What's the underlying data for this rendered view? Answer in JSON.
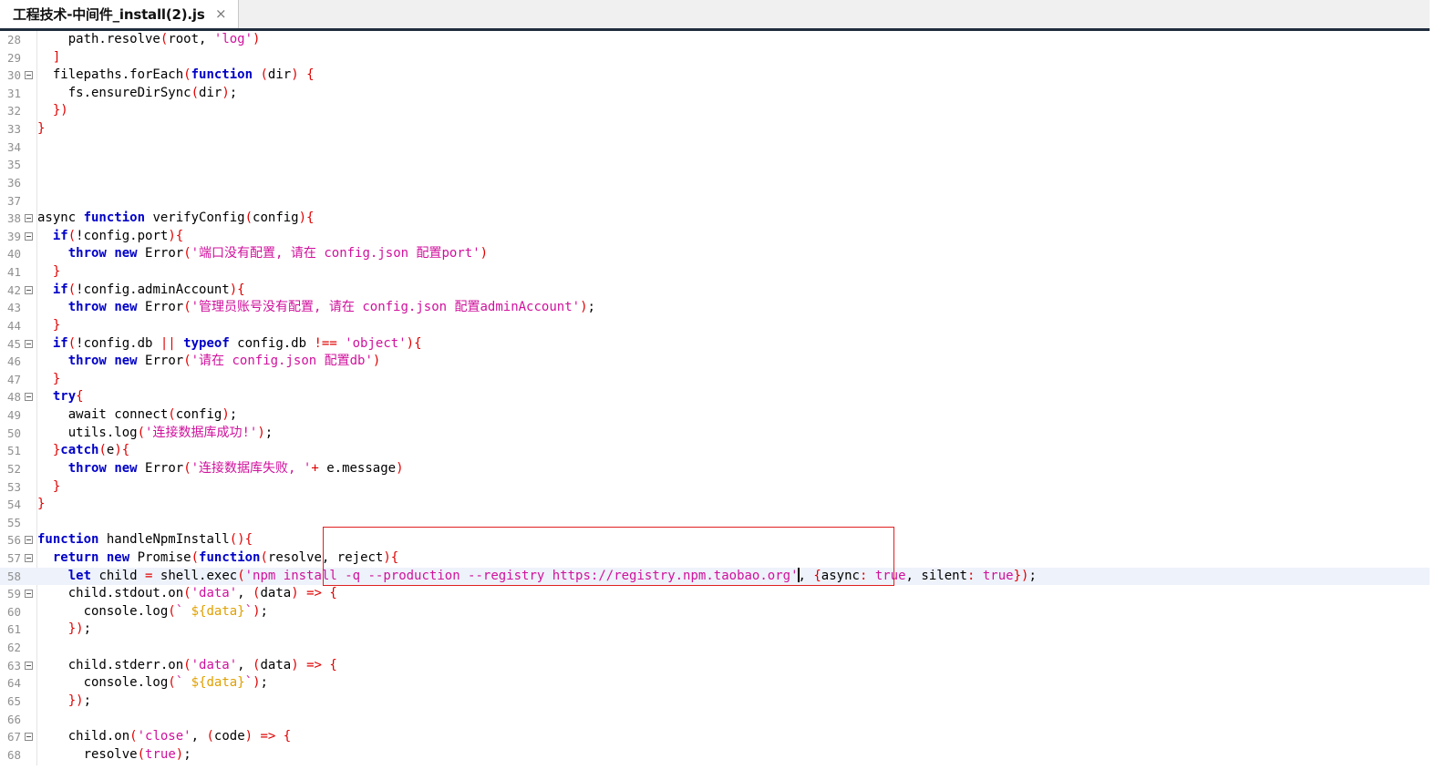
{
  "tab": {
    "title": "工程技术-中间件_install(2).js",
    "close_glyph": "×"
  },
  "editor": {
    "current_line": 58,
    "lines": [
      {
        "n": "28",
        "fold": false,
        "indent": 2,
        "tokens": [
          [
            "t",
            "path.resolve"
          ],
          [
            "br",
            "("
          ],
          [
            "t",
            "root, "
          ],
          [
            "str",
            "'log'"
          ],
          [
            "br",
            ")"
          ]
        ]
      },
      {
        "n": "29",
        "fold": false,
        "indent": 1,
        "tokens": [
          [
            "br",
            "]"
          ]
        ]
      },
      {
        "n": "30",
        "fold": true,
        "indent": 1,
        "tokens": [
          [
            "t",
            "filepaths.forEach"
          ],
          [
            "br",
            "("
          ],
          [
            "kw",
            "function"
          ],
          [
            "t",
            " "
          ],
          [
            "br",
            "("
          ],
          [
            "t",
            "dir"
          ],
          [
            "br",
            ")"
          ],
          [
            "t",
            " "
          ],
          [
            "br",
            "{"
          ]
        ]
      },
      {
        "n": "31",
        "fold": false,
        "indent": 2,
        "tokens": [
          [
            "t",
            "fs.ensureDirSync"
          ],
          [
            "br",
            "("
          ],
          [
            "t",
            "dir"
          ],
          [
            "br",
            ")"
          ],
          [
            "t",
            ";"
          ]
        ]
      },
      {
        "n": "32",
        "fold": false,
        "indent": 1,
        "tokens": [
          [
            "br",
            "})"
          ]
        ]
      },
      {
        "n": "33",
        "fold": false,
        "indent": 0,
        "tokens": [
          [
            "br",
            "}"
          ]
        ]
      },
      {
        "n": "34",
        "fold": false,
        "indent": 0,
        "tokens": []
      },
      {
        "n": "35",
        "fold": false,
        "indent": 0,
        "tokens": []
      },
      {
        "n": "36",
        "fold": false,
        "indent": 0,
        "tokens": []
      },
      {
        "n": "37",
        "fold": false,
        "indent": 0,
        "tokens": []
      },
      {
        "n": "38",
        "fold": true,
        "indent": 0,
        "tokens": [
          [
            "t",
            "async "
          ],
          [
            "kw",
            "function"
          ],
          [
            "t",
            " verifyConfig"
          ],
          [
            "br",
            "("
          ],
          [
            "t",
            "config"
          ],
          [
            "br",
            "){"
          ]
        ]
      },
      {
        "n": "39",
        "fold": true,
        "indent": 1,
        "tokens": [
          [
            "kw",
            "if"
          ],
          [
            "br",
            "("
          ],
          [
            "t",
            "!config.port"
          ],
          [
            "br",
            "){"
          ]
        ]
      },
      {
        "n": "40",
        "fold": false,
        "indent": 2,
        "tokens": [
          [
            "kw",
            "throw"
          ],
          [
            "t",
            " "
          ],
          [
            "kw",
            "new"
          ],
          [
            "t",
            " Error"
          ],
          [
            "br",
            "("
          ],
          [
            "str",
            "'端口没有配置, 请在 config.json 配置port'"
          ],
          [
            "br",
            ")"
          ]
        ]
      },
      {
        "n": "41",
        "fold": false,
        "indent": 1,
        "tokens": [
          [
            "br",
            "}"
          ]
        ]
      },
      {
        "n": "42",
        "fold": true,
        "indent": 1,
        "tokens": [
          [
            "kw",
            "if"
          ],
          [
            "br",
            "("
          ],
          [
            "t",
            "!config.adminAccount"
          ],
          [
            "br",
            "){"
          ]
        ]
      },
      {
        "n": "43",
        "fold": false,
        "indent": 2,
        "tokens": [
          [
            "kw",
            "throw"
          ],
          [
            "t",
            " "
          ],
          [
            "kw",
            "new"
          ],
          [
            "t",
            " Error"
          ],
          [
            "br",
            "("
          ],
          [
            "str",
            "'管理员账号没有配置, 请在 config.json 配置adminAccount'"
          ],
          [
            "br",
            ")"
          ],
          [
            "t",
            ";"
          ]
        ]
      },
      {
        "n": "44",
        "fold": false,
        "indent": 1,
        "tokens": [
          [
            "br",
            "}"
          ]
        ]
      },
      {
        "n": "45",
        "fold": true,
        "indent": 1,
        "tokens": [
          [
            "kw",
            "if"
          ],
          [
            "br",
            "("
          ],
          [
            "t",
            "!config.db "
          ],
          [
            "br",
            "||"
          ],
          [
            "t",
            " "
          ],
          [
            "kw",
            "typeof"
          ],
          [
            "t",
            " config.db "
          ],
          [
            "br",
            "!=="
          ],
          [
            "t",
            " "
          ],
          [
            "str",
            "'object'"
          ],
          [
            "br",
            "){"
          ]
        ]
      },
      {
        "n": "46",
        "fold": false,
        "indent": 2,
        "tokens": [
          [
            "kw",
            "throw"
          ],
          [
            "t",
            " "
          ],
          [
            "kw",
            "new"
          ],
          [
            "t",
            " Error"
          ],
          [
            "br",
            "("
          ],
          [
            "str",
            "'请在 config.json 配置db'"
          ],
          [
            "br",
            ")"
          ]
        ]
      },
      {
        "n": "47",
        "fold": false,
        "indent": 1,
        "tokens": [
          [
            "br",
            "}"
          ]
        ]
      },
      {
        "n": "48",
        "fold": true,
        "indent": 1,
        "tokens": [
          [
            "kw",
            "try"
          ],
          [
            "br",
            "{"
          ]
        ]
      },
      {
        "n": "49",
        "fold": false,
        "indent": 2,
        "tokens": [
          [
            "t",
            "await connect"
          ],
          [
            "br",
            "("
          ],
          [
            "t",
            "config"
          ],
          [
            "br",
            ")"
          ],
          [
            "t",
            ";"
          ]
        ]
      },
      {
        "n": "50",
        "fold": false,
        "indent": 2,
        "tokens": [
          [
            "t",
            "utils.log"
          ],
          [
            "br",
            "("
          ],
          [
            "str",
            "'连接数据库成功!'"
          ],
          [
            "br",
            ")"
          ],
          [
            "t",
            ";"
          ]
        ]
      },
      {
        "n": "51",
        "fold": false,
        "indent": 1,
        "tokens": [
          [
            "br",
            "}"
          ],
          [
            "kw",
            "catch"
          ],
          [
            "br",
            "("
          ],
          [
            "t",
            "e"
          ],
          [
            "br",
            "){"
          ]
        ]
      },
      {
        "n": "52",
        "fold": false,
        "indent": 2,
        "tokens": [
          [
            "kw",
            "throw"
          ],
          [
            "t",
            " "
          ],
          [
            "kw",
            "new"
          ],
          [
            "t",
            " Error"
          ],
          [
            "br",
            "("
          ],
          [
            "str",
            "'连接数据库失败, '"
          ],
          [
            "br",
            "+"
          ],
          [
            "t",
            " e.message"
          ],
          [
            "br",
            ")"
          ]
        ]
      },
      {
        "n": "53",
        "fold": false,
        "indent": 1,
        "tokens": [
          [
            "br",
            "}"
          ]
        ]
      },
      {
        "n": "54",
        "fold": false,
        "indent": 0,
        "tokens": [
          [
            "br",
            "}"
          ]
        ]
      },
      {
        "n": "55",
        "fold": false,
        "indent": 0,
        "tokens": []
      },
      {
        "n": "56",
        "fold": true,
        "indent": 0,
        "tokens": [
          [
            "kw",
            "function"
          ],
          [
            "t",
            " handleNpmInstall"
          ],
          [
            "br",
            "(){"
          ]
        ]
      },
      {
        "n": "57",
        "fold": true,
        "indent": 1,
        "tokens": [
          [
            "kw",
            "return"
          ],
          [
            "t",
            " "
          ],
          [
            "kw",
            "new"
          ],
          [
            "t",
            " Promise"
          ],
          [
            "br",
            "("
          ],
          [
            "kw",
            "function"
          ],
          [
            "br",
            "("
          ],
          [
            "t",
            "resolve, reject"
          ],
          [
            "br",
            "){"
          ]
        ]
      },
      {
        "n": "58",
        "fold": false,
        "indent": 2,
        "tokens": [
          [
            "kw",
            "let"
          ],
          [
            "t",
            " child "
          ],
          [
            "br",
            "="
          ],
          [
            "t",
            " shell.exec"
          ],
          [
            "br",
            "("
          ],
          [
            "str",
            "'npm install -q --production --registry https://registry.npm.taobao.org'"
          ],
          [
            "caret",
            ""
          ],
          [
            "t",
            ", "
          ],
          [
            "br",
            "{"
          ],
          [
            "t",
            "async"
          ],
          [
            "br",
            ":"
          ],
          [
            "t",
            " "
          ],
          [
            "str",
            "true"
          ],
          [
            "t",
            ", silent"
          ],
          [
            "br",
            ":"
          ],
          [
            "t",
            " "
          ],
          [
            "str",
            "true"
          ],
          [
            "br",
            "})"
          ],
          [
            "t",
            ";"
          ]
        ]
      },
      {
        "n": "59",
        "fold": true,
        "indent": 2,
        "tokens": [
          [
            "t",
            "child.stdout.on"
          ],
          [
            "br",
            "("
          ],
          [
            "str",
            "'data'"
          ],
          [
            "t",
            ", "
          ],
          [
            "br",
            "("
          ],
          [
            "t",
            "data"
          ],
          [
            "br",
            ")"
          ],
          [
            "t",
            " "
          ],
          [
            "br",
            "=>"
          ],
          [
            "t",
            " "
          ],
          [
            "br",
            "{"
          ]
        ]
      },
      {
        "n": "60",
        "fold": false,
        "indent": 3,
        "tokens": [
          [
            "t",
            "console.log"
          ],
          [
            "br",
            "("
          ],
          [
            "str",
            "`"
          ],
          [
            "t",
            " "
          ],
          [
            "tpl",
            "${data}"
          ],
          [
            "str",
            "`"
          ],
          [
            "br",
            ")"
          ],
          [
            "t",
            ";"
          ]
        ]
      },
      {
        "n": "61",
        "fold": false,
        "indent": 2,
        "tokens": [
          [
            "br",
            "})"
          ],
          [
            "t",
            ";"
          ]
        ]
      },
      {
        "n": "62",
        "fold": false,
        "indent": 0,
        "tokens": []
      },
      {
        "n": "63",
        "fold": true,
        "indent": 2,
        "tokens": [
          [
            "t",
            "child.stderr.on"
          ],
          [
            "br",
            "("
          ],
          [
            "str",
            "'data'"
          ],
          [
            "t",
            ", "
          ],
          [
            "br",
            "("
          ],
          [
            "t",
            "data"
          ],
          [
            "br",
            ")"
          ],
          [
            "t",
            " "
          ],
          [
            "br",
            "=>"
          ],
          [
            "t",
            " "
          ],
          [
            "br",
            "{"
          ]
        ]
      },
      {
        "n": "64",
        "fold": false,
        "indent": 3,
        "tokens": [
          [
            "t",
            "console.log"
          ],
          [
            "br",
            "("
          ],
          [
            "str",
            "`"
          ],
          [
            "t",
            " "
          ],
          [
            "tpl",
            "${data}"
          ],
          [
            "str",
            "`"
          ],
          [
            "br",
            ")"
          ],
          [
            "t",
            ";"
          ]
        ]
      },
      {
        "n": "65",
        "fold": false,
        "indent": 2,
        "tokens": [
          [
            "br",
            "})"
          ],
          [
            "t",
            ";"
          ]
        ]
      },
      {
        "n": "66",
        "fold": false,
        "indent": 0,
        "tokens": []
      },
      {
        "n": "67",
        "fold": true,
        "indent": 2,
        "tokens": [
          [
            "t",
            "child.on"
          ],
          [
            "br",
            "("
          ],
          [
            "str",
            "'close'"
          ],
          [
            "t",
            ", "
          ],
          [
            "br",
            "("
          ],
          [
            "t",
            "code"
          ],
          [
            "br",
            ")"
          ],
          [
            "t",
            " "
          ],
          [
            "br",
            "=>"
          ],
          [
            "t",
            " "
          ],
          [
            "br",
            "{"
          ]
        ]
      },
      {
        "n": "68",
        "fold": false,
        "indent": 3,
        "tokens": [
          [
            "t",
            "resolve"
          ],
          [
            "br",
            "("
          ],
          [
            "str",
            "true"
          ],
          [
            "br",
            ")"
          ],
          [
            "t",
            ";"
          ]
        ]
      }
    ]
  }
}
